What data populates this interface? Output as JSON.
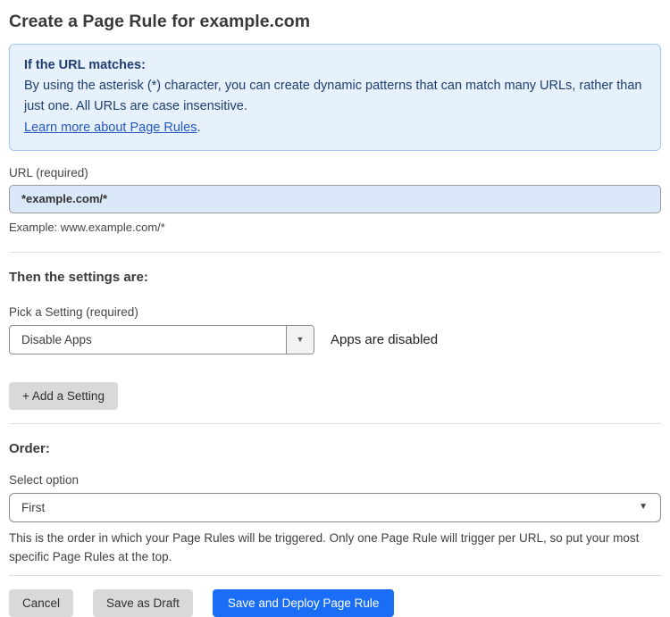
{
  "page": {
    "title": "Create a Page Rule for example.com"
  },
  "info_box": {
    "heading": "If the URL matches:",
    "body": "By using the asterisk (*) character, you can create dynamic patterns that can match many URLs, rather than just one. All URLs are case insensitive.",
    "link_label": "Learn more about Page Rules",
    "link_suffix": "."
  },
  "url_field": {
    "label": "URL (required)",
    "value": "*example.com/*",
    "example": "Example: www.example.com/*"
  },
  "settings_section": {
    "heading": "Then the settings are:",
    "setting_label": "Pick a Setting (required)",
    "setting_value": "Disable Apps",
    "setting_status": "Apps are disabled",
    "add_setting_label": "+ Add a Setting"
  },
  "order_section": {
    "heading": "Order:",
    "label": "Select option",
    "value": "First",
    "help": "This is the order in which your Page Rules will be triggered. Only one Page Rule will trigger per URL, so put your most specific Page Rules at the top."
  },
  "footer": {
    "cancel_label": "Cancel",
    "save_draft_label": "Save as Draft",
    "save_deploy_label": "Save and Deploy Page Rule"
  },
  "icons": {
    "dropdown_caret": "▼"
  },
  "colors": {
    "accent_blue": "#1a6ef5",
    "info_bg": "#e7f1fc",
    "info_border": "#a3c6ee",
    "info_text": "#1f3d70",
    "link_blue": "#2358c0",
    "input_bg": "#dbe8fa",
    "button_gray": "#d9d9d9"
  }
}
